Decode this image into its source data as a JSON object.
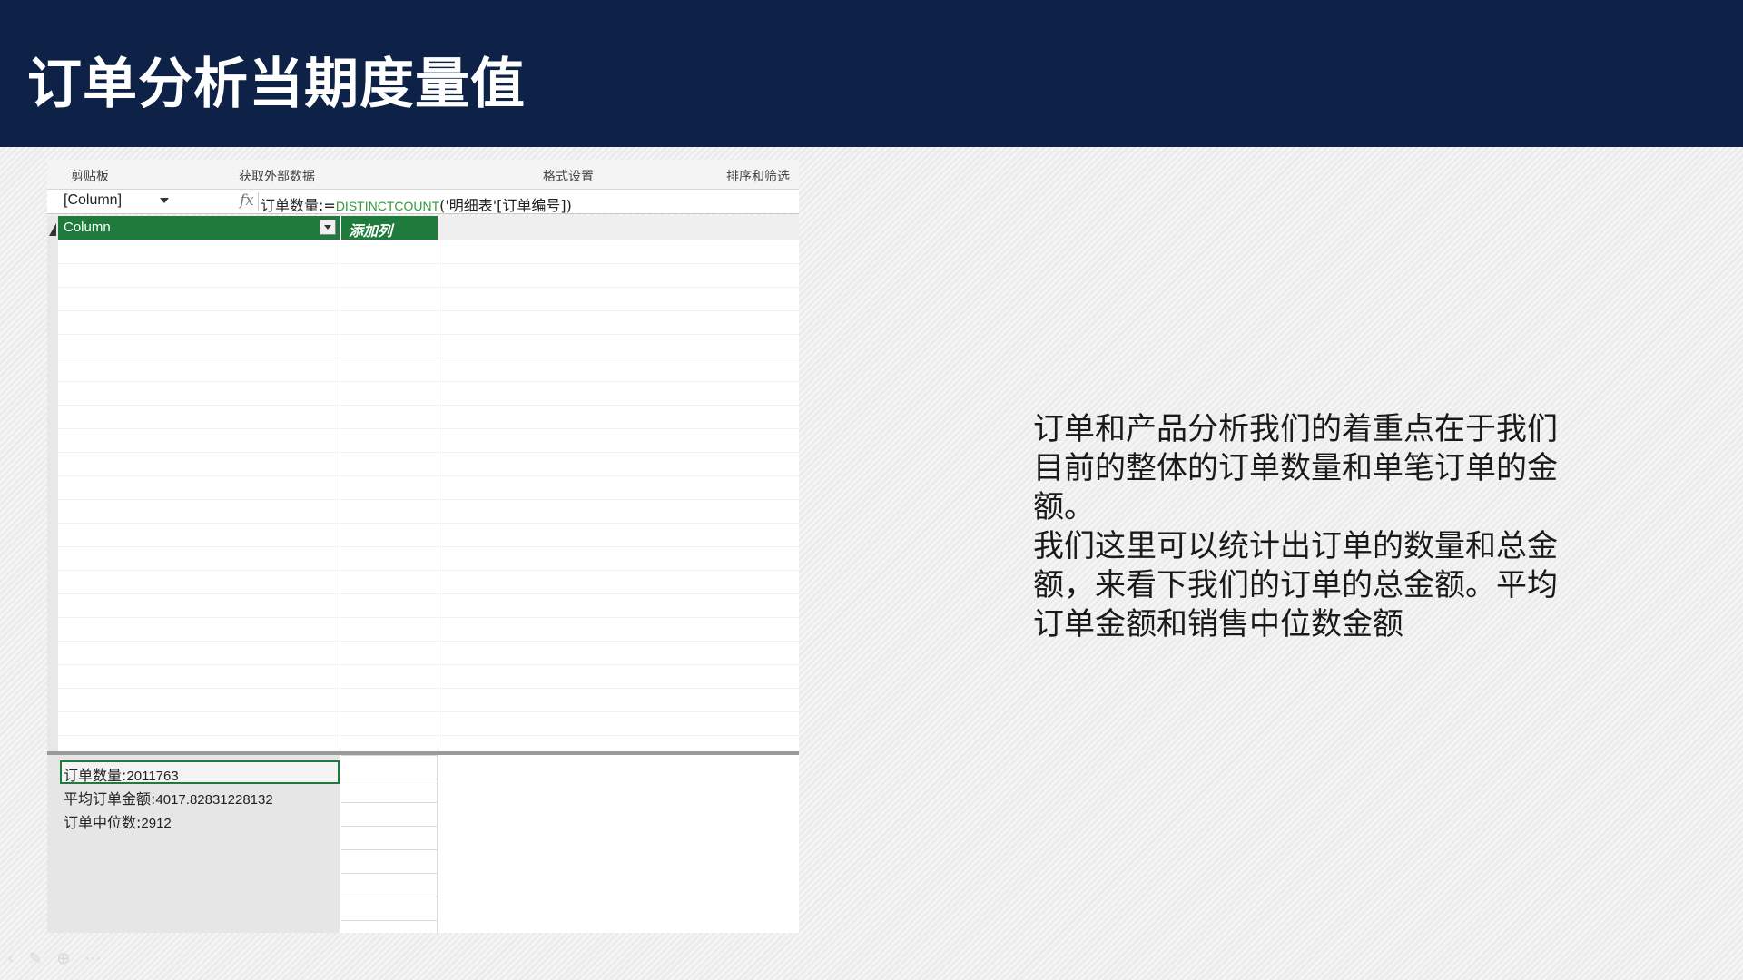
{
  "slide": {
    "title": "订单分析当期度量值",
    "description": [
      "订单和产品分析我们的着重点在于我们目前的整体的订单数量和单笔订单的金额。",
      "我们这里可以统计出订单的数量和总金额，来看下我们的订单的总金额。平均订单金额和销售中位数金额"
    ]
  },
  "excel": {
    "ribbon_groups": [
      "剪贴板",
      "获取外部数据",
      "格式设置",
      "排序和筛选"
    ],
    "namebox": "[Column]",
    "fx": "fx",
    "formula": {
      "measure_name": "订单数量:=",
      "function": "DISTINCTCOUNT",
      "argument": "('明细表'[订单编号])"
    },
    "columns": [
      "Column",
      "添加列"
    ],
    "measures": [
      {
        "label": "订单数量:",
        "value": "2011763"
      },
      {
        "label": "平均订单金额:",
        "value": "4017.82831228132"
      },
      {
        "label": "订单中位数:",
        "value": "2912"
      }
    ],
    "colors": {
      "accent": "#1e7b3c",
      "header_bg": "#0e2147",
      "formula_fn": "#2e9a3a"
    }
  }
}
